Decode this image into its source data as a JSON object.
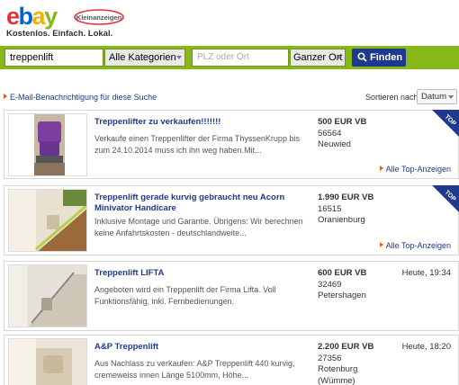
{
  "header": {
    "logo_text": "ebay",
    "logo_badge": "Kleinanzeigen",
    "slogan": "Kostenlos. Einfach. Lokal."
  },
  "search": {
    "query_value": "treppenlift",
    "category_value": "Alle Kategorien",
    "location_placeholder": "PLZ oder Ort",
    "radius_value": "Ganzer Ort",
    "submit_label": "Finden",
    "accent_color": "#86b817",
    "button_color": "#1d3a8f"
  },
  "results_bar": {
    "email_alert_label": "E-Mail-Benachrichtigung für diese Suche",
    "sort_label": "Sortieren nach:",
    "sort_value": "Datum"
  },
  "top_badge_label": "TOP",
  "top_ads_link_label": "Alle Top-Anzeigen",
  "ads": [
    {
      "title": "Treppenlifter zu verkaufen!!!!!!!",
      "description": "Verkaufe einen Treppenlifter der Firma ThyssenKrupp bis zum 24.10.2014 muss ich ihn weg haben.Mit...",
      "price": "500 EUR VB",
      "zip": "56564",
      "city": "Neuwied",
      "time": "",
      "is_top": true
    },
    {
      "title": "Treppenlift gerade kurvig gebraucht neu Acorn Minivator Handicare",
      "description": "Inklusive Montage und Garantie. Übrigens: Wir berechnen keine Anfahrtskosten - deutschlandweite...",
      "price": "1.990 EUR VB",
      "zip": "16515",
      "city": "Oranienburg",
      "time": "",
      "is_top": true
    },
    {
      "title": "Treppenlift LIFTA",
      "description": "Angeboten wird ein Treppenlift der Firma Lifta. Voll Funktionsfähig, inkl. Fernbedienungen.",
      "price": "600 EUR VB",
      "zip": "32469",
      "city": "Petershagen",
      "time": "Heute, 19:34",
      "is_top": false
    },
    {
      "title": "A&P Treppenlift",
      "description": "Aus Nachlass zu verkaufen: A&P Treppenlift 440 kurvig, cremeweiss innen Länge 5100mm, Höhe...",
      "price": "2.200 EUR VB",
      "zip": "27356",
      "city": "Rotenburg (Wümme)",
      "time": "Heute, 18:20",
      "is_top": false
    }
  ]
}
